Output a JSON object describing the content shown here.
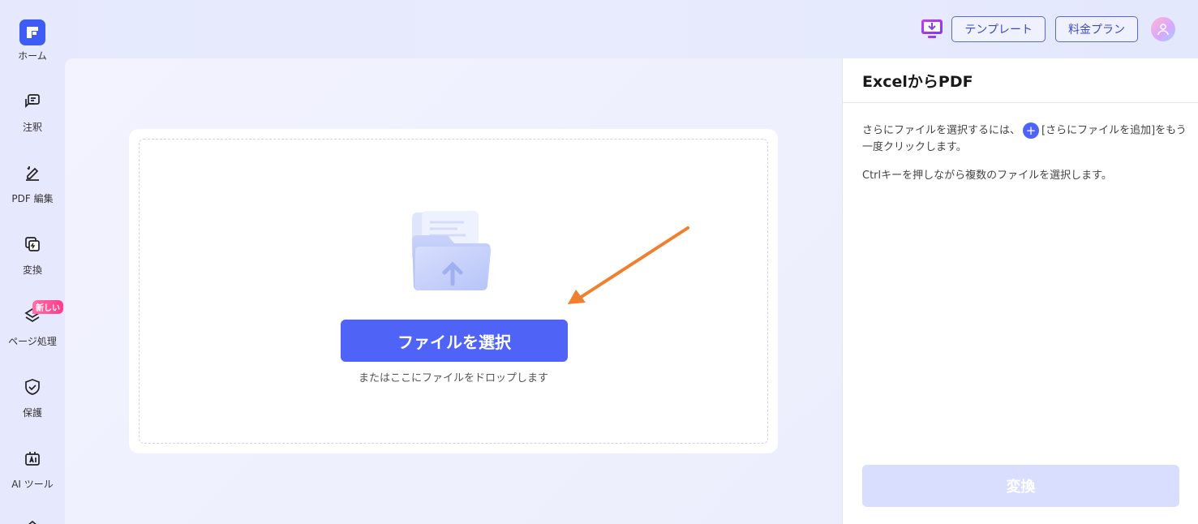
{
  "sidebar": {
    "items": [
      {
        "label": "ホーム",
        "icon": "home-logo-icon"
      },
      {
        "label": "注釈",
        "icon": "comment-icon"
      },
      {
        "label": "PDF 編集",
        "icon": "edit-pen-icon"
      },
      {
        "label": "変換",
        "icon": "convert-icon"
      },
      {
        "label": "ページ処理",
        "icon": "layers-icon",
        "badge": "新しい"
      },
      {
        "label": "保護",
        "icon": "shield-icon"
      },
      {
        "label": "AI ツール",
        "icon": "ai-tool-icon"
      }
    ]
  },
  "topbar": {
    "template_label": "テンプレート",
    "pricing_label": "料金プラン"
  },
  "dropzone": {
    "select_button": "ファイルを選択",
    "hint": "またはここにファイルをドロップします"
  },
  "panel": {
    "title": "ExcelからPDF",
    "text_before_icon": "さらにファイルを選択するには、",
    "text_after_icon": "[さらにファイルを追加]をもう一度クリックします。",
    "text_ctrl": "Ctrlキーを押しながら複数のファイルを選択します。",
    "convert_button": "変換"
  },
  "colors": {
    "accent": "#4f63f7",
    "arrow": "#f07f2e",
    "disabled_button": "#d9defe"
  }
}
